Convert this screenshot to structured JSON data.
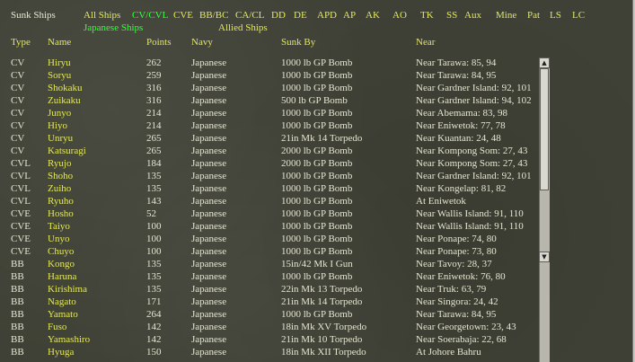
{
  "title": "Sunk Ships",
  "filters": [
    "All Ships",
    "CV/CVL",
    "CVE",
    "BB/BC",
    "CA/CL",
    "DD",
    "DE",
    "APD",
    "AP",
    "AK",
    "AO",
    "TK",
    "SS",
    "Aux",
    "Mine",
    "Pat",
    "LS",
    "LC"
  ],
  "active_filter": "CV/CVL",
  "sides": [
    "Japanese Ships",
    "Allied Ships"
  ],
  "active_side": "Japanese Ships",
  "columns": {
    "type": "Type",
    "name": "Name",
    "points": "Points",
    "navy": "Navy",
    "sunk_by": "Sunk By",
    "near": "Near"
  },
  "rows": [
    {
      "type": "CV",
      "name": "Hiryu",
      "points": "262",
      "navy": "Japanese",
      "sunk_by": "1000 lb GP Bomb",
      "near": "Near Tarawa: 85, 94"
    },
    {
      "type": "CV",
      "name": "Soryu",
      "points": "259",
      "navy": "Japanese",
      "sunk_by": "1000 lb GP Bomb",
      "near": "Near Tarawa: 84, 95"
    },
    {
      "type": "CV",
      "name": "Shokaku",
      "points": "316",
      "navy": "Japanese",
      "sunk_by": "1000 lb GP Bomb",
      "near": "Near Gardner Island: 92, 101"
    },
    {
      "type": "CV",
      "name": "Zuikaku",
      "points": "316",
      "navy": "Japanese",
      "sunk_by": "500 lb GP Bomb",
      "near": "Near Gardner Island: 94, 102"
    },
    {
      "type": "CV",
      "name": "Junyo",
      "points": "214",
      "navy": "Japanese",
      "sunk_by": "1000 lb GP Bomb",
      "near": "Near Abemama: 83, 98"
    },
    {
      "type": "CV",
      "name": "Hiyo",
      "points": "214",
      "navy": "Japanese",
      "sunk_by": "1000 lb GP Bomb",
      "near": "Near Eniwetok: 77, 78"
    },
    {
      "type": "CV",
      "name": "Unryu",
      "points": "265",
      "navy": "Japanese",
      "sunk_by": "21in Mk 14 Torpedo",
      "near": "Near Kuantan: 24, 48"
    },
    {
      "type": "CV",
      "name": "Katsuragi",
      "points": "265",
      "navy": "Japanese",
      "sunk_by": "2000 lb GP Bomb",
      "near": "Near Kompong Som: 27, 43"
    },
    {
      "type": "CVL",
      "name": "Ryujo",
      "points": "184",
      "navy": "Japanese",
      "sunk_by": "2000 lb GP Bomb",
      "near": "Near Kompong Som: 27, 43"
    },
    {
      "type": "CVL",
      "name": "Shoho",
      "points": "135",
      "navy": "Japanese",
      "sunk_by": "1000 lb GP Bomb",
      "near": "Near Gardner Island: 92, 101"
    },
    {
      "type": "CVL",
      "name": "Zuiho",
      "points": "135",
      "navy": "Japanese",
      "sunk_by": "1000 lb GP Bomb",
      "near": "Near Kongelap: 81, 82"
    },
    {
      "type": "CVL",
      "name": "Ryuho",
      "points": "143",
      "navy": "Japanese",
      "sunk_by": "1000 lb GP Bomb",
      "near": "At Eniwetok"
    },
    {
      "type": "CVE",
      "name": "Hosho",
      "points": "52",
      "navy": "Japanese",
      "sunk_by": "1000 lb GP Bomb",
      "near": "Near Wallis Island: 91, 110"
    },
    {
      "type": "CVE",
      "name": "Taiyo",
      "points": "100",
      "navy": "Japanese",
      "sunk_by": "1000 lb GP Bomb",
      "near": "Near Wallis Island: 91, 110"
    },
    {
      "type": "CVE",
      "name": "Unyo",
      "points": "100",
      "navy": "Japanese",
      "sunk_by": "1000 lb GP Bomb",
      "near": "Near Ponape: 74, 80"
    },
    {
      "type": "CVE",
      "name": "Chuyo",
      "points": "100",
      "navy": "Japanese",
      "sunk_by": "1000 lb GP Bomb",
      "near": "Near Ponape: 73, 80"
    },
    {
      "type": "BB",
      "name": "Kongo",
      "points": "135",
      "navy": "Japanese",
      "sunk_by": "15in/42 Mk I Gun",
      "near": "Near Tavoy: 28, 37"
    },
    {
      "type": "BB",
      "name": "Haruna",
      "points": "135",
      "navy": "Japanese",
      "sunk_by": "1000 lb GP Bomb",
      "near": "Near Eniwetok: 76, 80"
    },
    {
      "type": "BB",
      "name": "Kirishima",
      "points": "135",
      "navy": "Japanese",
      "sunk_by": "22in Mk 13 Torpedo",
      "near": "Near Truk: 63, 79"
    },
    {
      "type": "BB",
      "name": "Nagato",
      "points": "171",
      "navy": "Japanese",
      "sunk_by": "21in Mk 14 Torpedo",
      "near": "Near Singora: 24, 42"
    },
    {
      "type": "BB",
      "name": "Yamato",
      "points": "264",
      "navy": "Japanese",
      "sunk_by": "1000 lb GP Bomb",
      "near": "Near Tarawa: 84, 95"
    },
    {
      "type": "BB",
      "name": "Fuso",
      "points": "142",
      "navy": "Japanese",
      "sunk_by": "18in Mk XV Torpedo",
      "near": "Near Georgetown: 23, 43"
    },
    {
      "type": "BB",
      "name": "Yamashiro",
      "points": "142",
      "navy": "Japanese",
      "sunk_by": "21in Mk 10 Torpedo",
      "near": "Near Soerabaja: 22, 68"
    },
    {
      "type": "BB",
      "name": "Hyuga",
      "points": "150",
      "navy": "Japanese",
      "sunk_by": "18in Mk XII Torpedo",
      "near": "At Johore Bahru"
    }
  ],
  "scrollbar": {
    "up_icon": "▲",
    "down_icon": "▼"
  }
}
